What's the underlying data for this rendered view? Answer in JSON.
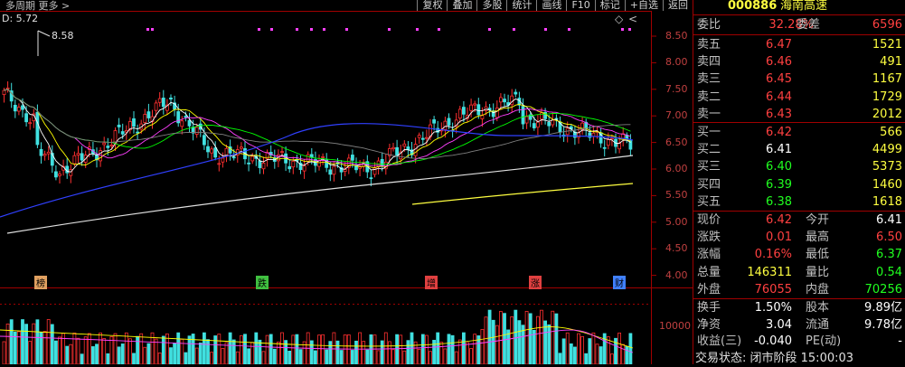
{
  "toolbar": {
    "period_label": "多周期",
    "more_label": "更多",
    "buttons": [
      "复权",
      "叠加",
      "多股",
      "统计",
      "画线",
      "F10",
      "标记",
      "+自选",
      "返回"
    ]
  },
  "main_chart": {
    "indicator_text": "D: 5.72",
    "high_label": "8.58",
    "y_ticks": [
      "8.50",
      "8.00",
      "7.50",
      "7.00",
      "6.50",
      "6.00",
      "5.50",
      "5.00",
      "4.50",
      "4.00"
    ],
    "markers": [
      {
        "text": "榜",
        "color": "#e0a060"
      },
      {
        "text": "跌",
        "color": "#40c040"
      },
      {
        "text": "增",
        "color": "#e04040"
      },
      {
        "text": "涨",
        "color": "#e04040"
      },
      {
        "text": "财",
        "color": "#4080ff"
      }
    ]
  },
  "volume_chart": {
    "y_tick": "10000"
  },
  "quote_panel": {
    "code": "000886",
    "name": "海南高速",
    "weibi_label": "委比",
    "weibi_value": "32.28%",
    "weicha_label": "委差",
    "weicha_value": "6596",
    "asks": [
      {
        "label": "卖五",
        "price": "6.47",
        "vol": "1521"
      },
      {
        "label": "卖四",
        "price": "6.46",
        "vol": "491"
      },
      {
        "label": "卖三",
        "price": "6.45",
        "vol": "1167"
      },
      {
        "label": "卖二",
        "price": "6.44",
        "vol": "1729"
      },
      {
        "label": "卖一",
        "price": "6.43",
        "vol": "2012"
      }
    ],
    "bids": [
      {
        "label": "买一",
        "price": "6.42",
        "vol": "566",
        "color": "red"
      },
      {
        "label": "买二",
        "price": "6.41",
        "vol": "4499",
        "color": "white"
      },
      {
        "label": "买三",
        "price": "6.40",
        "vol": "5373",
        "color": "green"
      },
      {
        "label": "买四",
        "price": "6.39",
        "vol": "1460",
        "color": "green"
      },
      {
        "label": "买五",
        "price": "6.38",
        "vol": "1618",
        "color": "green"
      }
    ],
    "stats": [
      {
        "l1": "现价",
        "v1": "6.42",
        "c1": "red",
        "l2": "今开",
        "v2": "6.41",
        "c2": "white"
      },
      {
        "l1": "涨跌",
        "v1": "0.01",
        "c1": "red",
        "l2": "最高",
        "v2": "6.50",
        "c2": "red"
      },
      {
        "l1": "涨幅",
        "v1": "0.16%",
        "c1": "red",
        "l2": "最低",
        "v2": "6.37",
        "c2": "green"
      },
      {
        "l1": "总量",
        "v1": "146311",
        "c1": "yellow",
        "l2": "量比",
        "v2": "0.54",
        "c2": "green"
      },
      {
        "l1": "外盘",
        "v1": "76055",
        "c1": "red",
        "l2": "内盘",
        "v2": "70256",
        "c2": "green"
      }
    ],
    "fundamentals": [
      {
        "l1": "换手",
        "v1": "1.50%",
        "l2": "股本",
        "v2": "9.89亿"
      },
      {
        "l1": "净资",
        "v1": "3.04",
        "l2": "流通",
        "v2": "9.78亿"
      },
      {
        "l1": "收益(三)",
        "v1": "-0.040",
        "l2": "PE(动)",
        "v2": "-"
      }
    ],
    "status_text": "交易状态: 闭市阶段 15:00:03"
  }
}
